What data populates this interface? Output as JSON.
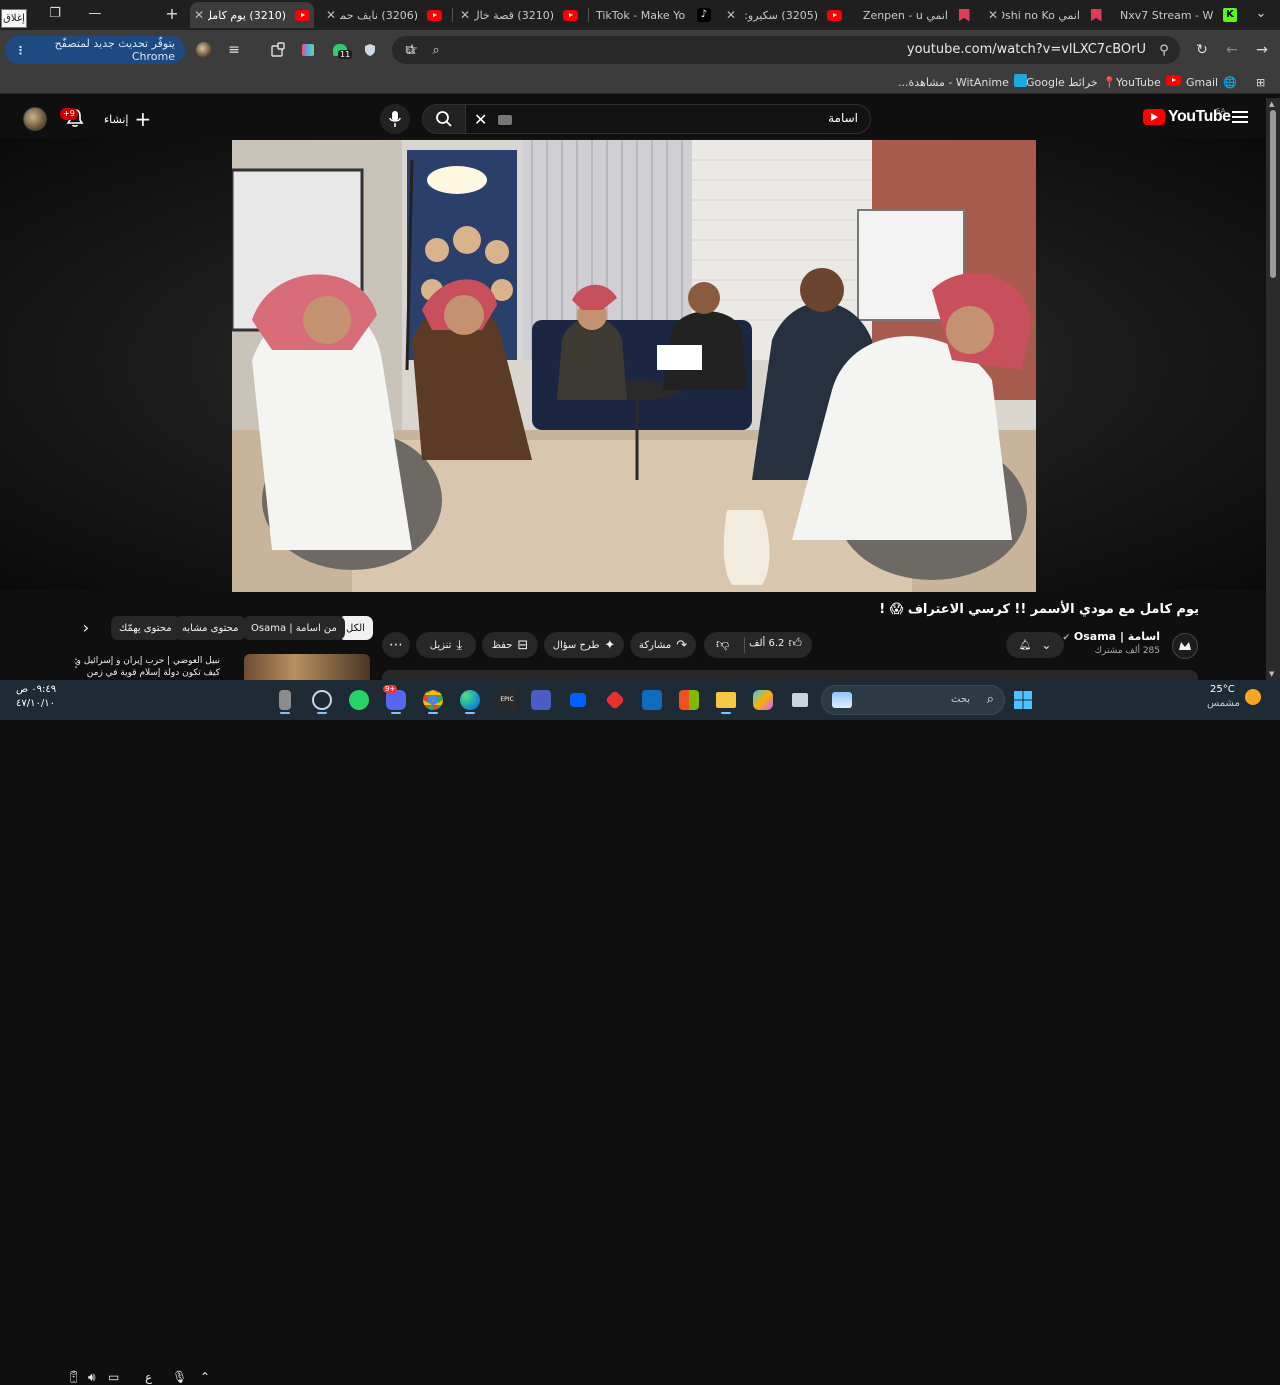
{
  "browser": {
    "close_tooltip": "إغلاق",
    "tabs": [
      {
        "title": "Nxv7 Stream - W",
        "favicon": "kick-icon",
        "active": false
      },
      {
        "title": "انمي Oshi no Ko",
        "favicon": "bookmark-icon",
        "active": false
      },
      {
        "title": "انمي Zenpen - u",
        "favicon": "bookmark-icon",
        "active": false
      },
      {
        "title": "(3205) سكيرو: شا",
        "favicon": "youtube-icon",
        "active": false
      },
      {
        "title": "TikTok - Make Yo",
        "favicon": "tiktok-icon",
        "active": false
      },
      {
        "title": "(3210) قصة خال",
        "favicon": "youtube-icon",
        "active": false
      },
      {
        "title": "(3206) نايف حمد",
        "favicon": "youtube-icon",
        "active": false
      },
      {
        "title": "(3210) يوم كامل",
        "favicon": "youtube-icon",
        "active": true
      }
    ],
    "update_button": "يتوفّر تحديث جديد لمتصفّح Chrome",
    "extension_badge": "11",
    "url": "youtube.com/watch?v=vlLXC7cBOrU",
    "bookmarks": [
      {
        "label": "Gmail",
        "icon": "globe-icon"
      },
      {
        "label": "YouTube",
        "icon": "youtube-icon"
      },
      {
        "label": "خرائط Google",
        "icon": "maps-icon"
      },
      {
        "label": "WitAnime - مشاهدة...",
        "icon": "witanime-icon"
      }
    ]
  },
  "youtube": {
    "logo_text": "YouTube",
    "country_code": "SA",
    "search_query": "اسامة",
    "create_label": "إنشاء",
    "notification_count": "+9",
    "video_title": "يوم كامل مع مودي الأسمر !! كرسي الاعتراف 😱 !",
    "channel_name": "اسامة | Osama",
    "channel_subscribers": "285 ألف مشترك",
    "likes": "6.2 ألف",
    "share_label": "مشاركة",
    "ask_label": "طرح سؤال",
    "save_label": "حفظ",
    "download_label": "تنزيل",
    "chips": [
      "الكل",
      "من اسامة | Osama",
      "محتوى مشابه",
      "محتوى يهمّك"
    ],
    "recommendation_title": "نبيل العوضي | حرب إيران و إسرائيل و كيف تكون دولة إسلام قوية في زمن رداءة العالم"
  },
  "taskbar": {
    "search_placeholder": "بحث",
    "weather_temp": "25°C",
    "weather_desc": "مشمس",
    "clock_time": "٠٩:٤٩ ص",
    "clock_date": "٤٧/١٠/١٠",
    "lang": "ع",
    "discord_badge": "9+"
  },
  "colors": {
    "accent": "#ff0000",
    "update_button_bg": "#1d4a80",
    "page_bg": "#0f0f0f",
    "taskbar_bg": "#1e2b35"
  }
}
